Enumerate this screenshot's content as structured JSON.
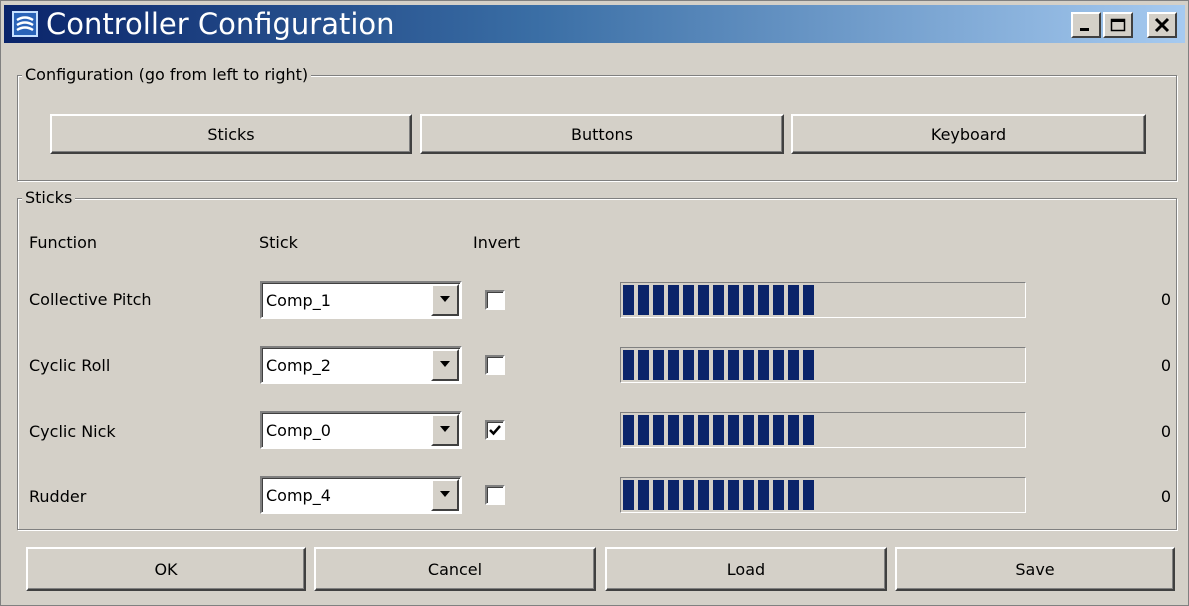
{
  "window": {
    "title": "Controller Configuration",
    "icon": "app-logo-icon",
    "controls": [
      "minimize-icon",
      "maximize-icon",
      "close-icon"
    ]
  },
  "config_group": {
    "legend": "Configuration (go from left to right)",
    "tabs": [
      "Sticks",
      "Buttons",
      "Keyboard"
    ]
  },
  "sticks_group": {
    "legend": "Sticks",
    "headers": {
      "function": "Function",
      "stick": "Stick",
      "invert": "Invert"
    },
    "rows": [
      {
        "function": "Collective Pitch",
        "stick": "Comp_1",
        "invert": false,
        "level": 0.5,
        "value": "0"
      },
      {
        "function": "Cyclic Roll",
        "stick": "Comp_2",
        "invert": false,
        "level": 0.5,
        "value": "0"
      },
      {
        "function": "Cyclic Nick",
        "stick": "Comp_0",
        "invert": true,
        "level": 0.5,
        "value": "0"
      },
      {
        "function": "Rudder",
        "stick": "Comp_4",
        "invert": false,
        "level": 0.5,
        "value": "0"
      }
    ]
  },
  "footer": {
    "ok": "OK",
    "cancel": "Cancel",
    "load": "Load",
    "save": "Save"
  },
  "colors": {
    "title_start": "#0a246a",
    "title_end": "#a6caf0",
    "progress_fill": "#0a246a",
    "face": "#d4d0c8"
  }
}
